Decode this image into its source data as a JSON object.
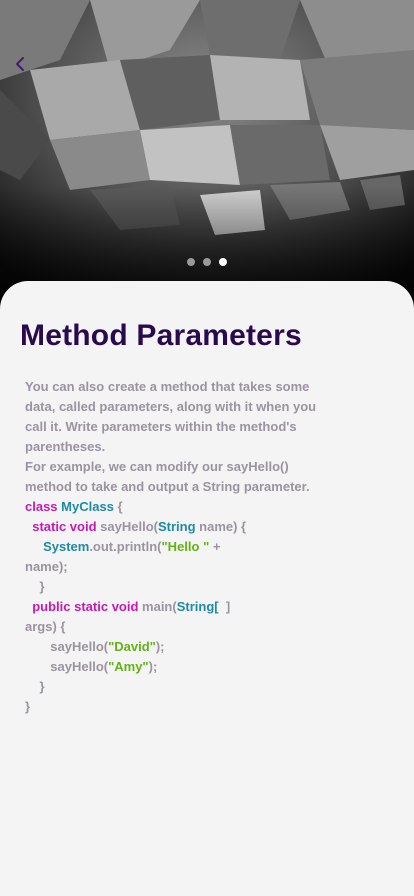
{
  "header": {
    "back_icon": "chevron-left-icon",
    "carousel": {
      "count": 3,
      "active_index": 2
    }
  },
  "lesson": {
    "title": "Method Parameters",
    "paragraph": [
      "You can also create a method that takes some",
      "data, called parameters, along with it when you",
      "call it. Write parameters within the method's",
      "parentheses.",
      "For example, we can modify our sayHello()",
      "method to take and output a String parameter."
    ],
    "code": [
      {
        "k": "kw",
        "t": "class "
      },
      {
        "k": "ty",
        "t": "MyClass"
      },
      {
        "k": "txt",
        "t": " {"
      }
    ]
  },
  "code_lines": [
    [
      {
        "k": "kw",
        "t": "class "
      },
      {
        "k": "ty",
        "t": "MyClass"
      },
      {
        "k": "txt",
        "t": " {"
      }
    ],
    [
      {
        "k": "txt",
        "t": "  "
      },
      {
        "k": "kw",
        "t": "static void "
      },
      {
        "k": "txt",
        "t": "sayHello("
      },
      {
        "k": "ty",
        "t": "String"
      },
      {
        "k": "txt",
        "t": " name) {"
      }
    ],
    [
      {
        "k": "txt",
        "t": "     "
      },
      {
        "k": "ty",
        "t": "System"
      },
      {
        "k": "txt",
        "t": ".out.println("
      },
      {
        "k": "st",
        "t": "\"Hello \""
      },
      {
        "k": "txt",
        "t": " +"
      }
    ],
    [
      {
        "k": "txt",
        "t": "name);"
      }
    ],
    [
      {
        "k": "txt",
        "t": "    }"
      }
    ],
    [
      {
        "k": "txt",
        "t": "  "
      },
      {
        "k": "kw",
        "t": "public static void "
      },
      {
        "k": "txt",
        "t": "main("
      },
      {
        "k": "ty",
        "t": "String["
      },
      {
        "k": "txt",
        "t": "  ]"
      }
    ],
    [
      {
        "k": "txt",
        "t": "args) {"
      }
    ],
    [
      {
        "k": "txt",
        "t": "       sayHello("
      },
      {
        "k": "st",
        "t": "\"David\""
      },
      {
        "k": "txt",
        "t": ");"
      }
    ],
    [
      {
        "k": "txt",
        "t": "       sayHello("
      },
      {
        "k": "st",
        "t": "\"Amy\""
      },
      {
        "k": "txt",
        "t": ");"
      }
    ],
    [
      {
        "k": "txt",
        "t": "    }"
      }
    ],
    [
      {
        "k": "txt",
        "t": "}"
      }
    ]
  ],
  "colors": {
    "title": "#2a0a4e",
    "body_text": "#9b93a0",
    "keyword": "#c21bb4",
    "type": "#1f8aa4",
    "string": "#64b315",
    "back_icon": "#3b1f6e"
  }
}
